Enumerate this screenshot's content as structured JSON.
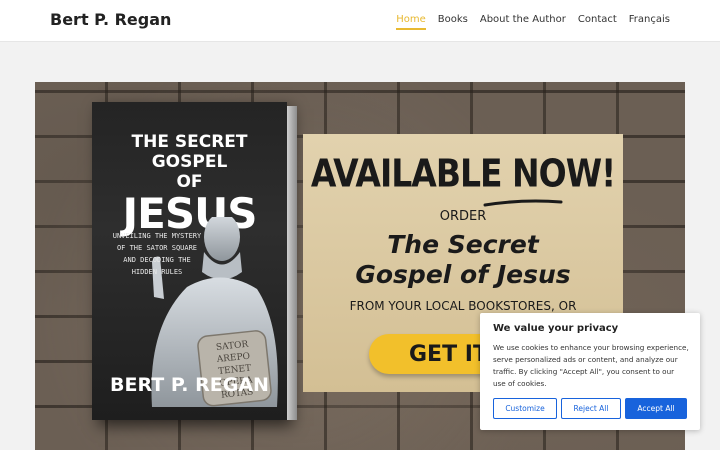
{
  "header": {
    "site_title": "Bert P. Regan",
    "nav": [
      {
        "label": "Home",
        "active": true
      },
      {
        "label": "Books",
        "active": false
      },
      {
        "label": "About the Author",
        "active": false
      },
      {
        "label": "Contact",
        "active": false
      },
      {
        "label": "Français",
        "active": false
      }
    ]
  },
  "hero": {
    "book": {
      "title_line1": "THE SECRET GOSPEL",
      "title_line2": "OF",
      "title_big": "JESUS",
      "subtitle": "UNVEILING THE MYSTERY OF THE SATOR SQUARE AND DECODING THE HIDDEN RULES",
      "tablet_lines": [
        "SATOR",
        "AREPO",
        "TENET",
        "OPERA",
        "ROTAS"
      ],
      "author": "BERT P. REGAN"
    },
    "promo": {
      "headline": "AVAILABLE NOW!",
      "order": "ORDER",
      "book_title_line1": "The Secret",
      "book_title_line2": "Gospel of Jesus",
      "stores": "FROM YOUR LOCAL BOOKSTORES, OR",
      "cta_label": "GET IT N"
    }
  },
  "cookie_banner": {
    "title": "We value your privacy",
    "text": "We use cookies to enhance your browsing experience, serve personalized ads or content, and analyze our traffic. By clicking \"Accept All\", you consent to our use of cookies.",
    "customize_label": "Customize",
    "reject_label": "Reject All",
    "accept_label": "Accept All"
  },
  "colors": {
    "accent": "#e8b931",
    "cookie_primary": "#1863dc",
    "cta_yellow": "#f2c02b"
  }
}
